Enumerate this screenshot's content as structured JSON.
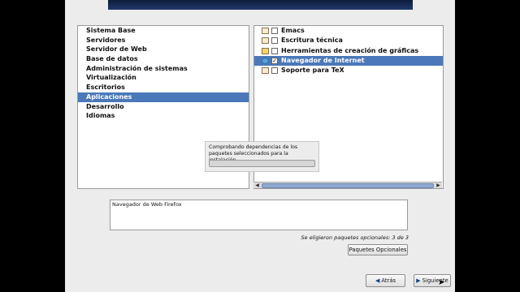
{
  "groups": [
    {
      "label": "Sistema Base"
    },
    {
      "label": "Servidores"
    },
    {
      "label": "Servidor de Web"
    },
    {
      "label": "Base de datos"
    },
    {
      "label": "Administración de sistemas"
    },
    {
      "label": "Virtualización"
    },
    {
      "label": "Escritorios"
    },
    {
      "label": "Aplicaciones",
      "selected": true
    },
    {
      "label": "Desarrollo"
    },
    {
      "label": "Idiomas"
    }
  ],
  "packages": [
    {
      "label": "Emacs",
      "checked": false,
      "icon": "emacs-icon"
    },
    {
      "label": "Escritura técnica",
      "checked": false,
      "icon": "book-icon"
    },
    {
      "label": "Herramientas de creación de gráficas",
      "checked": false,
      "icon": "graphics-icon"
    },
    {
      "label": "Navegador de Internet",
      "checked": true,
      "icon": "globe-icon",
      "selected": true
    },
    {
      "label": "Soporte para TeX",
      "checked": false,
      "icon": "book-icon"
    }
  ],
  "progress": {
    "text": "Comprobando dependencias de los paquetes seleccionados para la instalación",
    "fraction": 0
  },
  "description": "Navegador de Web Firefox",
  "selected_count_text": "Se eligieron paquetes opcionales: 3 de 3",
  "buttons": {
    "optional": "Paquetes Opcionales",
    "back": "Atrás",
    "next": "Siguiente"
  },
  "colors": {
    "selection": "#4a78b9",
    "window_bg": "#ececec",
    "banner": "#1b2d55"
  }
}
